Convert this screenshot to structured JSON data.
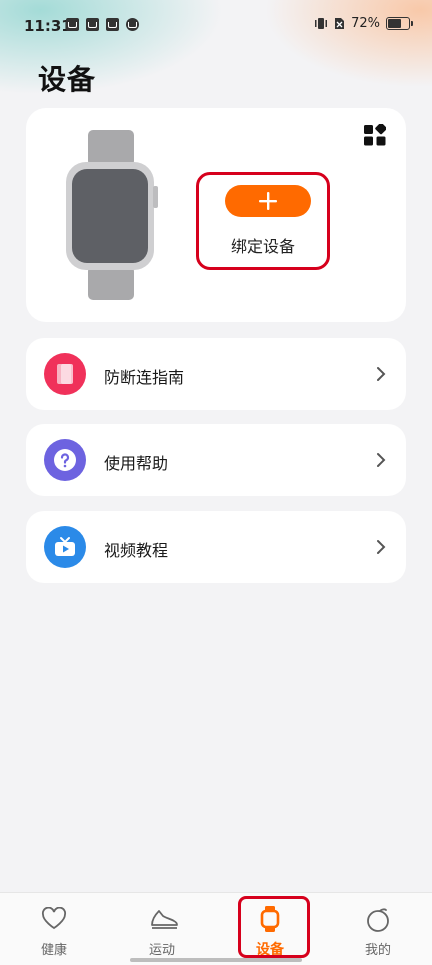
{
  "status_bar": {
    "time": "11:31",
    "battery_text": "72%",
    "battery_level": 0.72
  },
  "page": {
    "title": "设备"
  },
  "device_card": {
    "bind_button_symbol": "+",
    "bind_label": "绑定设备"
  },
  "menu": [
    {
      "label": "防断连指南",
      "icon": "guide-icon",
      "color": "#f0315a"
    },
    {
      "label": "使用帮助",
      "icon": "help-icon",
      "color": "#6d63e0"
    },
    {
      "label": "视频教程",
      "icon": "video-icon",
      "color": "#2b8ae8"
    }
  ],
  "bottom_nav": [
    {
      "label": "健康",
      "icon": "heart-icon",
      "active": false
    },
    {
      "label": "运动",
      "icon": "shoe-icon",
      "active": false
    },
    {
      "label": "设备",
      "icon": "watch-icon",
      "active": true
    },
    {
      "label": "我的",
      "icon": "profile-icon",
      "active": false
    }
  ],
  "colors": {
    "accent": "#ff6a00",
    "highlight": "#d6001c"
  }
}
